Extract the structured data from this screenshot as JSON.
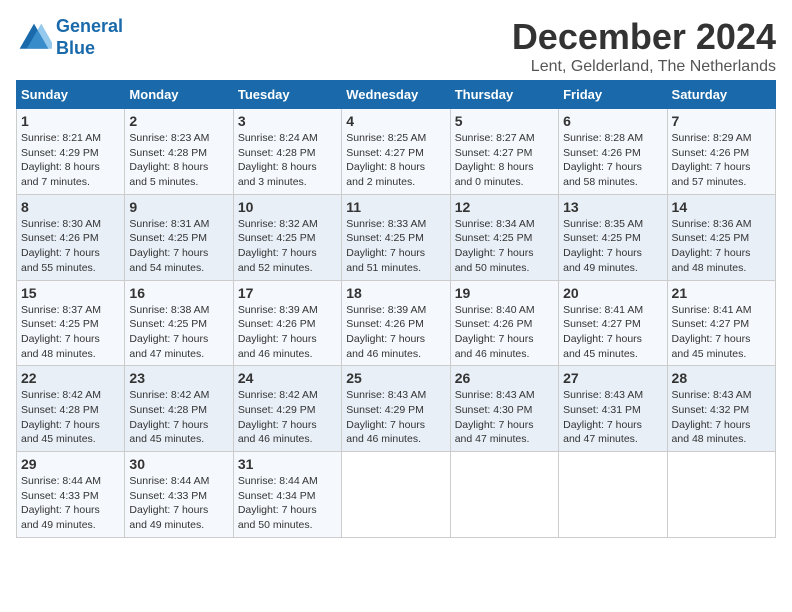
{
  "logo": {
    "line1": "General",
    "line2": "Blue"
  },
  "title": "December 2024",
  "subtitle": "Lent, Gelderland, The Netherlands",
  "headers": [
    "Sunday",
    "Monday",
    "Tuesday",
    "Wednesday",
    "Thursday",
    "Friday",
    "Saturday"
  ],
  "weeks": [
    [
      {
        "day": "1",
        "lines": [
          "Sunrise: 8:21 AM",
          "Sunset: 4:29 PM",
          "Daylight: 8 hours",
          "and 7 minutes."
        ]
      },
      {
        "day": "2",
        "lines": [
          "Sunrise: 8:23 AM",
          "Sunset: 4:28 PM",
          "Daylight: 8 hours",
          "and 5 minutes."
        ]
      },
      {
        "day": "3",
        "lines": [
          "Sunrise: 8:24 AM",
          "Sunset: 4:28 PM",
          "Daylight: 8 hours",
          "and 3 minutes."
        ]
      },
      {
        "day": "4",
        "lines": [
          "Sunrise: 8:25 AM",
          "Sunset: 4:27 PM",
          "Daylight: 8 hours",
          "and 2 minutes."
        ]
      },
      {
        "day": "5",
        "lines": [
          "Sunrise: 8:27 AM",
          "Sunset: 4:27 PM",
          "Daylight: 8 hours",
          "and 0 minutes."
        ]
      },
      {
        "day": "6",
        "lines": [
          "Sunrise: 8:28 AM",
          "Sunset: 4:26 PM",
          "Daylight: 7 hours",
          "and 58 minutes."
        ]
      },
      {
        "day": "7",
        "lines": [
          "Sunrise: 8:29 AM",
          "Sunset: 4:26 PM",
          "Daylight: 7 hours",
          "and 57 minutes."
        ]
      }
    ],
    [
      {
        "day": "8",
        "lines": [
          "Sunrise: 8:30 AM",
          "Sunset: 4:26 PM",
          "Daylight: 7 hours",
          "and 55 minutes."
        ]
      },
      {
        "day": "9",
        "lines": [
          "Sunrise: 8:31 AM",
          "Sunset: 4:25 PM",
          "Daylight: 7 hours",
          "and 54 minutes."
        ]
      },
      {
        "day": "10",
        "lines": [
          "Sunrise: 8:32 AM",
          "Sunset: 4:25 PM",
          "Daylight: 7 hours",
          "and 52 minutes."
        ]
      },
      {
        "day": "11",
        "lines": [
          "Sunrise: 8:33 AM",
          "Sunset: 4:25 PM",
          "Daylight: 7 hours",
          "and 51 minutes."
        ]
      },
      {
        "day": "12",
        "lines": [
          "Sunrise: 8:34 AM",
          "Sunset: 4:25 PM",
          "Daylight: 7 hours",
          "and 50 minutes."
        ]
      },
      {
        "day": "13",
        "lines": [
          "Sunrise: 8:35 AM",
          "Sunset: 4:25 PM",
          "Daylight: 7 hours",
          "and 49 minutes."
        ]
      },
      {
        "day": "14",
        "lines": [
          "Sunrise: 8:36 AM",
          "Sunset: 4:25 PM",
          "Daylight: 7 hours",
          "and 48 minutes."
        ]
      }
    ],
    [
      {
        "day": "15",
        "lines": [
          "Sunrise: 8:37 AM",
          "Sunset: 4:25 PM",
          "Daylight: 7 hours",
          "and 48 minutes."
        ]
      },
      {
        "day": "16",
        "lines": [
          "Sunrise: 8:38 AM",
          "Sunset: 4:25 PM",
          "Daylight: 7 hours",
          "and 47 minutes."
        ]
      },
      {
        "day": "17",
        "lines": [
          "Sunrise: 8:39 AM",
          "Sunset: 4:26 PM",
          "Daylight: 7 hours",
          "and 46 minutes."
        ]
      },
      {
        "day": "18",
        "lines": [
          "Sunrise: 8:39 AM",
          "Sunset: 4:26 PM",
          "Daylight: 7 hours",
          "and 46 minutes."
        ]
      },
      {
        "day": "19",
        "lines": [
          "Sunrise: 8:40 AM",
          "Sunset: 4:26 PM",
          "Daylight: 7 hours",
          "and 46 minutes."
        ]
      },
      {
        "day": "20",
        "lines": [
          "Sunrise: 8:41 AM",
          "Sunset: 4:27 PM",
          "Daylight: 7 hours",
          "and 45 minutes."
        ]
      },
      {
        "day": "21",
        "lines": [
          "Sunrise: 8:41 AM",
          "Sunset: 4:27 PM",
          "Daylight: 7 hours",
          "and 45 minutes."
        ]
      }
    ],
    [
      {
        "day": "22",
        "lines": [
          "Sunrise: 8:42 AM",
          "Sunset: 4:28 PM",
          "Daylight: 7 hours",
          "and 45 minutes."
        ]
      },
      {
        "day": "23",
        "lines": [
          "Sunrise: 8:42 AM",
          "Sunset: 4:28 PM",
          "Daylight: 7 hours",
          "and 45 minutes."
        ]
      },
      {
        "day": "24",
        "lines": [
          "Sunrise: 8:42 AM",
          "Sunset: 4:29 PM",
          "Daylight: 7 hours",
          "and 46 minutes."
        ]
      },
      {
        "day": "25",
        "lines": [
          "Sunrise: 8:43 AM",
          "Sunset: 4:29 PM",
          "Daylight: 7 hours",
          "and 46 minutes."
        ]
      },
      {
        "day": "26",
        "lines": [
          "Sunrise: 8:43 AM",
          "Sunset: 4:30 PM",
          "Daylight: 7 hours",
          "and 47 minutes."
        ]
      },
      {
        "day": "27",
        "lines": [
          "Sunrise: 8:43 AM",
          "Sunset: 4:31 PM",
          "Daylight: 7 hours",
          "and 47 minutes."
        ]
      },
      {
        "day": "28",
        "lines": [
          "Sunrise: 8:43 AM",
          "Sunset: 4:32 PM",
          "Daylight: 7 hours",
          "and 48 minutes."
        ]
      }
    ],
    [
      {
        "day": "29",
        "lines": [
          "Sunrise: 8:44 AM",
          "Sunset: 4:33 PM",
          "Daylight: 7 hours",
          "and 49 minutes."
        ]
      },
      {
        "day": "30",
        "lines": [
          "Sunrise: 8:44 AM",
          "Sunset: 4:33 PM",
          "Daylight: 7 hours",
          "and 49 minutes."
        ]
      },
      {
        "day": "31",
        "lines": [
          "Sunrise: 8:44 AM",
          "Sunset: 4:34 PM",
          "Daylight: 7 hours",
          "and 50 minutes."
        ]
      },
      null,
      null,
      null,
      null
    ]
  ]
}
